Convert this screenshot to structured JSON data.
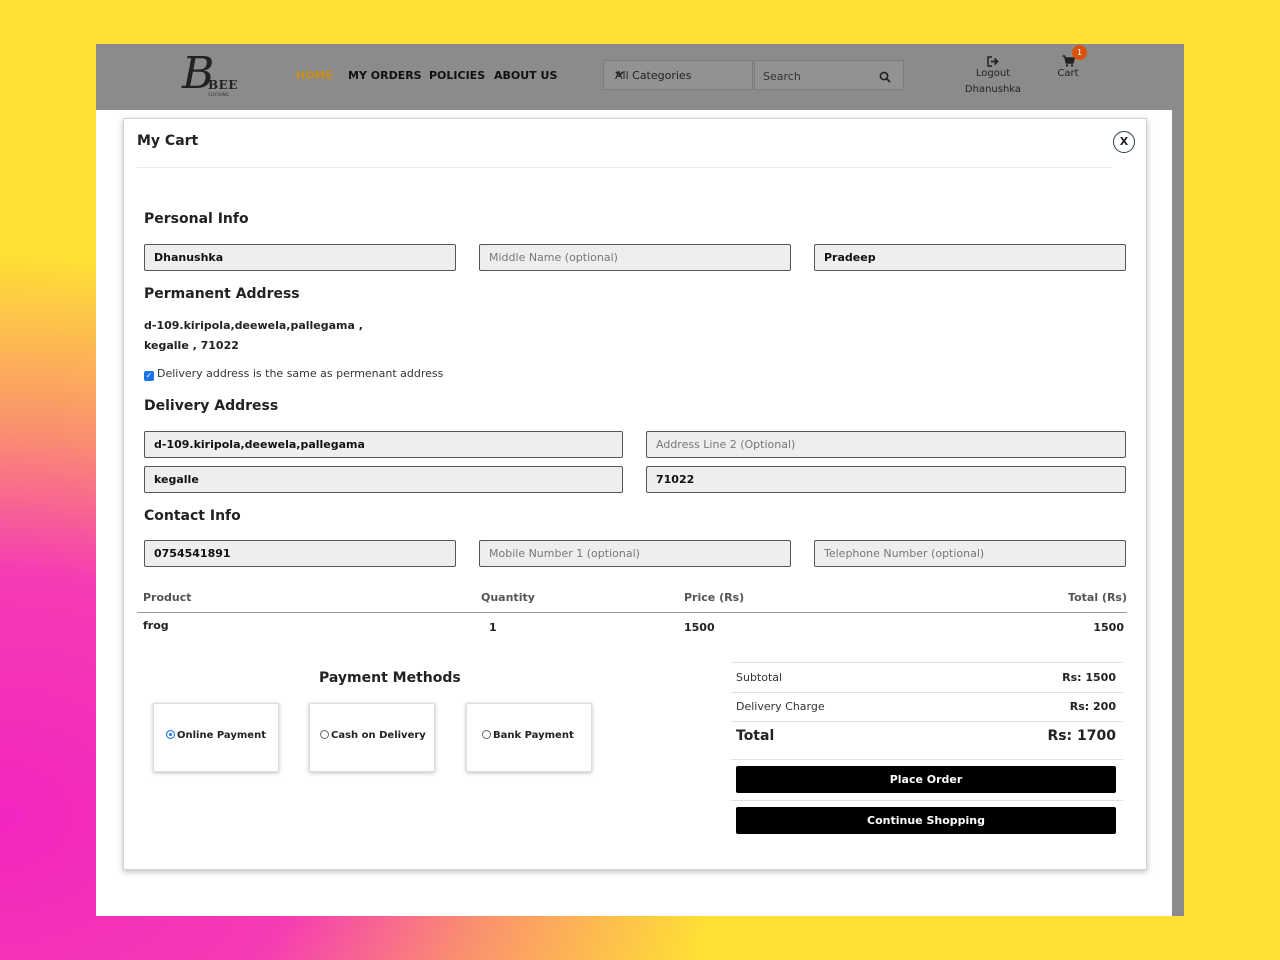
{
  "header": {
    "logo_letter": "B",
    "logo_text": "BEE",
    "logo_subtext": "CLOTHING",
    "nav": [
      "HOME",
      "MY ORDERS",
      "POLICIES",
      "ABOUT US"
    ],
    "category_select": "All Categories",
    "search_placeholder": "Search",
    "logout_label": "Logout",
    "username": "Dhanushka",
    "cart_label": "Cart",
    "cart_count": "1",
    "active_color": "#c8901a",
    "badge_color": "#d9520d"
  },
  "modal": {
    "title": "My Cart",
    "close": "X"
  },
  "personal": {
    "heading": "Personal Info",
    "first_name": "Dhanushka",
    "middle_name": "",
    "middle_placeholder": "Middle Name (optional)",
    "last_name": "Pradeep"
  },
  "permanent": {
    "heading": "Permanent Address",
    "line1": "d-109.kiripola,deewela,pallegama ,",
    "line2": "kegalle , 71022",
    "same_checkbox_label": "Delivery address is the same as permenant address",
    "same_checked": true
  },
  "delivery": {
    "heading": "Delivery Address",
    "address_line1": "d-109.kiripola,deewela,pallegama",
    "address_line2": "",
    "address_line2_placeholder": "Address Line 2 (Optional)",
    "city": "kegalle",
    "postal": "71022"
  },
  "contact": {
    "heading": "Contact Info",
    "mobile": "0754541891",
    "mobile1_placeholder": "Mobile Number 1 (optional)",
    "telephone_placeholder": "Telephone Number (optional)"
  },
  "table": {
    "headers": [
      "Product",
      "Quantity",
      "Price (Rs)",
      "Total (Rs)"
    ],
    "rows": [
      [
        "frog",
        "1",
        "1500",
        "1500"
      ]
    ]
  },
  "payment": {
    "title": "Payment Methods",
    "options": [
      "Online Payment",
      "Cash on Delivery",
      "Bank Payment"
    ],
    "selected": "Online Payment"
  },
  "summary": {
    "subtotal_label": "Subtotal",
    "subtotal_value": "Rs: 1500",
    "delivery_label": "Delivery Charge",
    "delivery_value": "Rs: 200",
    "total_label": "Total",
    "total_value": "Rs: 1700",
    "place_order": "Place Order",
    "continue_shopping": "Continue Shopping"
  }
}
